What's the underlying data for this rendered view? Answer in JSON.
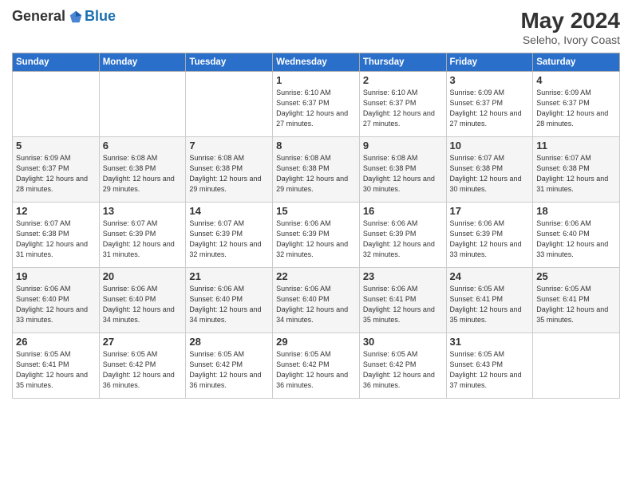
{
  "header": {
    "logo_general": "General",
    "logo_blue": "Blue",
    "month_year": "May 2024",
    "location": "Seleho, Ivory Coast"
  },
  "days_of_week": [
    "Sunday",
    "Monday",
    "Tuesday",
    "Wednesday",
    "Thursday",
    "Friday",
    "Saturday"
  ],
  "weeks": [
    [
      null,
      null,
      null,
      {
        "day": "1",
        "sunrise": "Sunrise: 6:10 AM",
        "sunset": "Sunset: 6:37 PM",
        "daylight": "Daylight: 12 hours and 27 minutes."
      },
      {
        "day": "2",
        "sunrise": "Sunrise: 6:10 AM",
        "sunset": "Sunset: 6:37 PM",
        "daylight": "Daylight: 12 hours and 27 minutes."
      },
      {
        "day": "3",
        "sunrise": "Sunrise: 6:09 AM",
        "sunset": "Sunset: 6:37 PM",
        "daylight": "Daylight: 12 hours and 27 minutes."
      },
      {
        "day": "4",
        "sunrise": "Sunrise: 6:09 AM",
        "sunset": "Sunset: 6:37 PM",
        "daylight": "Daylight: 12 hours and 28 minutes."
      }
    ],
    [
      {
        "day": "5",
        "sunrise": "Sunrise: 6:09 AM",
        "sunset": "Sunset: 6:37 PM",
        "daylight": "Daylight: 12 hours and 28 minutes."
      },
      {
        "day": "6",
        "sunrise": "Sunrise: 6:08 AM",
        "sunset": "Sunset: 6:38 PM",
        "daylight": "Daylight: 12 hours and 29 minutes."
      },
      {
        "day": "7",
        "sunrise": "Sunrise: 6:08 AM",
        "sunset": "Sunset: 6:38 PM",
        "daylight": "Daylight: 12 hours and 29 minutes."
      },
      {
        "day": "8",
        "sunrise": "Sunrise: 6:08 AM",
        "sunset": "Sunset: 6:38 PM",
        "daylight": "Daylight: 12 hours and 29 minutes."
      },
      {
        "day": "9",
        "sunrise": "Sunrise: 6:08 AM",
        "sunset": "Sunset: 6:38 PM",
        "daylight": "Daylight: 12 hours and 30 minutes."
      },
      {
        "day": "10",
        "sunrise": "Sunrise: 6:07 AM",
        "sunset": "Sunset: 6:38 PM",
        "daylight": "Daylight: 12 hours and 30 minutes."
      },
      {
        "day": "11",
        "sunrise": "Sunrise: 6:07 AM",
        "sunset": "Sunset: 6:38 PM",
        "daylight": "Daylight: 12 hours and 31 minutes."
      }
    ],
    [
      {
        "day": "12",
        "sunrise": "Sunrise: 6:07 AM",
        "sunset": "Sunset: 6:38 PM",
        "daylight": "Daylight: 12 hours and 31 minutes."
      },
      {
        "day": "13",
        "sunrise": "Sunrise: 6:07 AM",
        "sunset": "Sunset: 6:39 PM",
        "daylight": "Daylight: 12 hours and 31 minutes."
      },
      {
        "day": "14",
        "sunrise": "Sunrise: 6:07 AM",
        "sunset": "Sunset: 6:39 PM",
        "daylight": "Daylight: 12 hours and 32 minutes."
      },
      {
        "day": "15",
        "sunrise": "Sunrise: 6:06 AM",
        "sunset": "Sunset: 6:39 PM",
        "daylight": "Daylight: 12 hours and 32 minutes."
      },
      {
        "day": "16",
        "sunrise": "Sunrise: 6:06 AM",
        "sunset": "Sunset: 6:39 PM",
        "daylight": "Daylight: 12 hours and 32 minutes."
      },
      {
        "day": "17",
        "sunrise": "Sunrise: 6:06 AM",
        "sunset": "Sunset: 6:39 PM",
        "daylight": "Daylight: 12 hours and 33 minutes."
      },
      {
        "day": "18",
        "sunrise": "Sunrise: 6:06 AM",
        "sunset": "Sunset: 6:40 PM",
        "daylight": "Daylight: 12 hours and 33 minutes."
      }
    ],
    [
      {
        "day": "19",
        "sunrise": "Sunrise: 6:06 AM",
        "sunset": "Sunset: 6:40 PM",
        "daylight": "Daylight: 12 hours and 33 minutes."
      },
      {
        "day": "20",
        "sunrise": "Sunrise: 6:06 AM",
        "sunset": "Sunset: 6:40 PM",
        "daylight": "Daylight: 12 hours and 34 minutes."
      },
      {
        "day": "21",
        "sunrise": "Sunrise: 6:06 AM",
        "sunset": "Sunset: 6:40 PM",
        "daylight": "Daylight: 12 hours and 34 minutes."
      },
      {
        "day": "22",
        "sunrise": "Sunrise: 6:06 AM",
        "sunset": "Sunset: 6:40 PM",
        "daylight": "Daylight: 12 hours and 34 minutes."
      },
      {
        "day": "23",
        "sunrise": "Sunrise: 6:06 AM",
        "sunset": "Sunset: 6:41 PM",
        "daylight": "Daylight: 12 hours and 35 minutes."
      },
      {
        "day": "24",
        "sunrise": "Sunrise: 6:05 AM",
        "sunset": "Sunset: 6:41 PM",
        "daylight": "Daylight: 12 hours and 35 minutes."
      },
      {
        "day": "25",
        "sunrise": "Sunrise: 6:05 AM",
        "sunset": "Sunset: 6:41 PM",
        "daylight": "Daylight: 12 hours and 35 minutes."
      }
    ],
    [
      {
        "day": "26",
        "sunrise": "Sunrise: 6:05 AM",
        "sunset": "Sunset: 6:41 PM",
        "daylight": "Daylight: 12 hours and 35 minutes."
      },
      {
        "day": "27",
        "sunrise": "Sunrise: 6:05 AM",
        "sunset": "Sunset: 6:42 PM",
        "daylight": "Daylight: 12 hours and 36 minutes."
      },
      {
        "day": "28",
        "sunrise": "Sunrise: 6:05 AM",
        "sunset": "Sunset: 6:42 PM",
        "daylight": "Daylight: 12 hours and 36 minutes."
      },
      {
        "day": "29",
        "sunrise": "Sunrise: 6:05 AM",
        "sunset": "Sunset: 6:42 PM",
        "daylight": "Daylight: 12 hours and 36 minutes."
      },
      {
        "day": "30",
        "sunrise": "Sunrise: 6:05 AM",
        "sunset": "Sunset: 6:42 PM",
        "daylight": "Daylight: 12 hours and 36 minutes."
      },
      {
        "day": "31",
        "sunrise": "Sunrise: 6:05 AM",
        "sunset": "Sunset: 6:43 PM",
        "daylight": "Daylight: 12 hours and 37 minutes."
      },
      null
    ]
  ]
}
